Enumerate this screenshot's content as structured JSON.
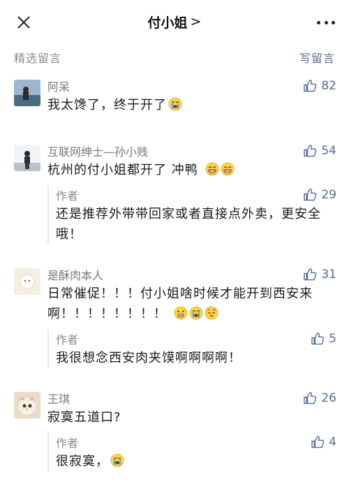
{
  "nav": {
    "title": "付小姐",
    "chevron": ">"
  },
  "bar": {
    "selected_label": "精选留言",
    "write_label": "写留言"
  },
  "comments": [
    {
      "author": "阿呆",
      "likes": "82",
      "text": "我太馋了，终于开了",
      "emojis": [
        "crying-face"
      ],
      "replies": []
    },
    {
      "author": "互联网绅士—孙小贱",
      "likes": "54",
      "text": "杭州的付小姐都开了 冲鸭",
      "emojis": [
        "grin-face",
        "grin-face"
      ],
      "replies": [
        {
          "author": "作者",
          "likes": "29",
          "text": "还是推荐外带带回家或者直接点外卖，更安全哦！"
        }
      ]
    },
    {
      "author": "是酥肉本人",
      "likes": "31",
      "text": "日常催促！！！付小姐啥时候才能开到西安来啊！！！！！！！！",
      "emojis": [
        "angry-face",
        "crying-face",
        "pensive-face"
      ],
      "replies": [
        {
          "author": "作者",
          "likes": "5",
          "text": "我很想念西安肉夹馍啊啊啊啊！"
        }
      ]
    },
    {
      "author": "王琪",
      "likes": "26",
      "text": "寂寞五道口?",
      "emojis": [],
      "replies": [
        {
          "author": "作者",
          "likes": "4",
          "text": "很寂寞，",
          "emojis": [
            "crying-face"
          ]
        }
      ]
    }
  ],
  "colors": {
    "link": "#576b95",
    "meta": "#8a8a8a",
    "text": "#1a1a1a"
  }
}
